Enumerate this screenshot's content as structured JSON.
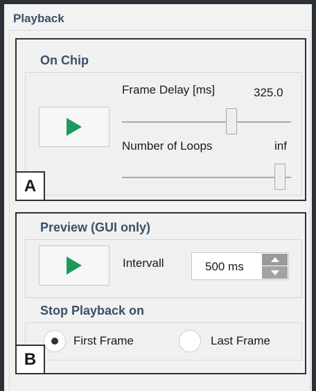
{
  "panel": {
    "title": "Playback"
  },
  "callouts": {
    "a": "A",
    "b": "B"
  },
  "on_chip": {
    "title": "On Chip",
    "play_icon": "play-icon",
    "frame_delay_label": "Frame Delay [ms]",
    "frame_delay_value": "325.0",
    "frame_delay_slider_fraction": 0.64,
    "loops_label": "Number of Loops",
    "loops_value": "inf",
    "loops_slider_fraction": 1.0
  },
  "preview": {
    "title": "Preview (GUI only)",
    "play_icon": "play-icon",
    "interval_label": "Intervall",
    "interval_value": "500 ms"
  },
  "stop_playback": {
    "title": "Stop Playback on",
    "options": [
      {
        "label": "First Frame",
        "selected": true
      },
      {
        "label": "Last Frame",
        "selected": false
      }
    ]
  },
  "colors": {
    "play": "#1a9a5c",
    "section_title": "#3a5068",
    "frame": "#2c3138"
  }
}
